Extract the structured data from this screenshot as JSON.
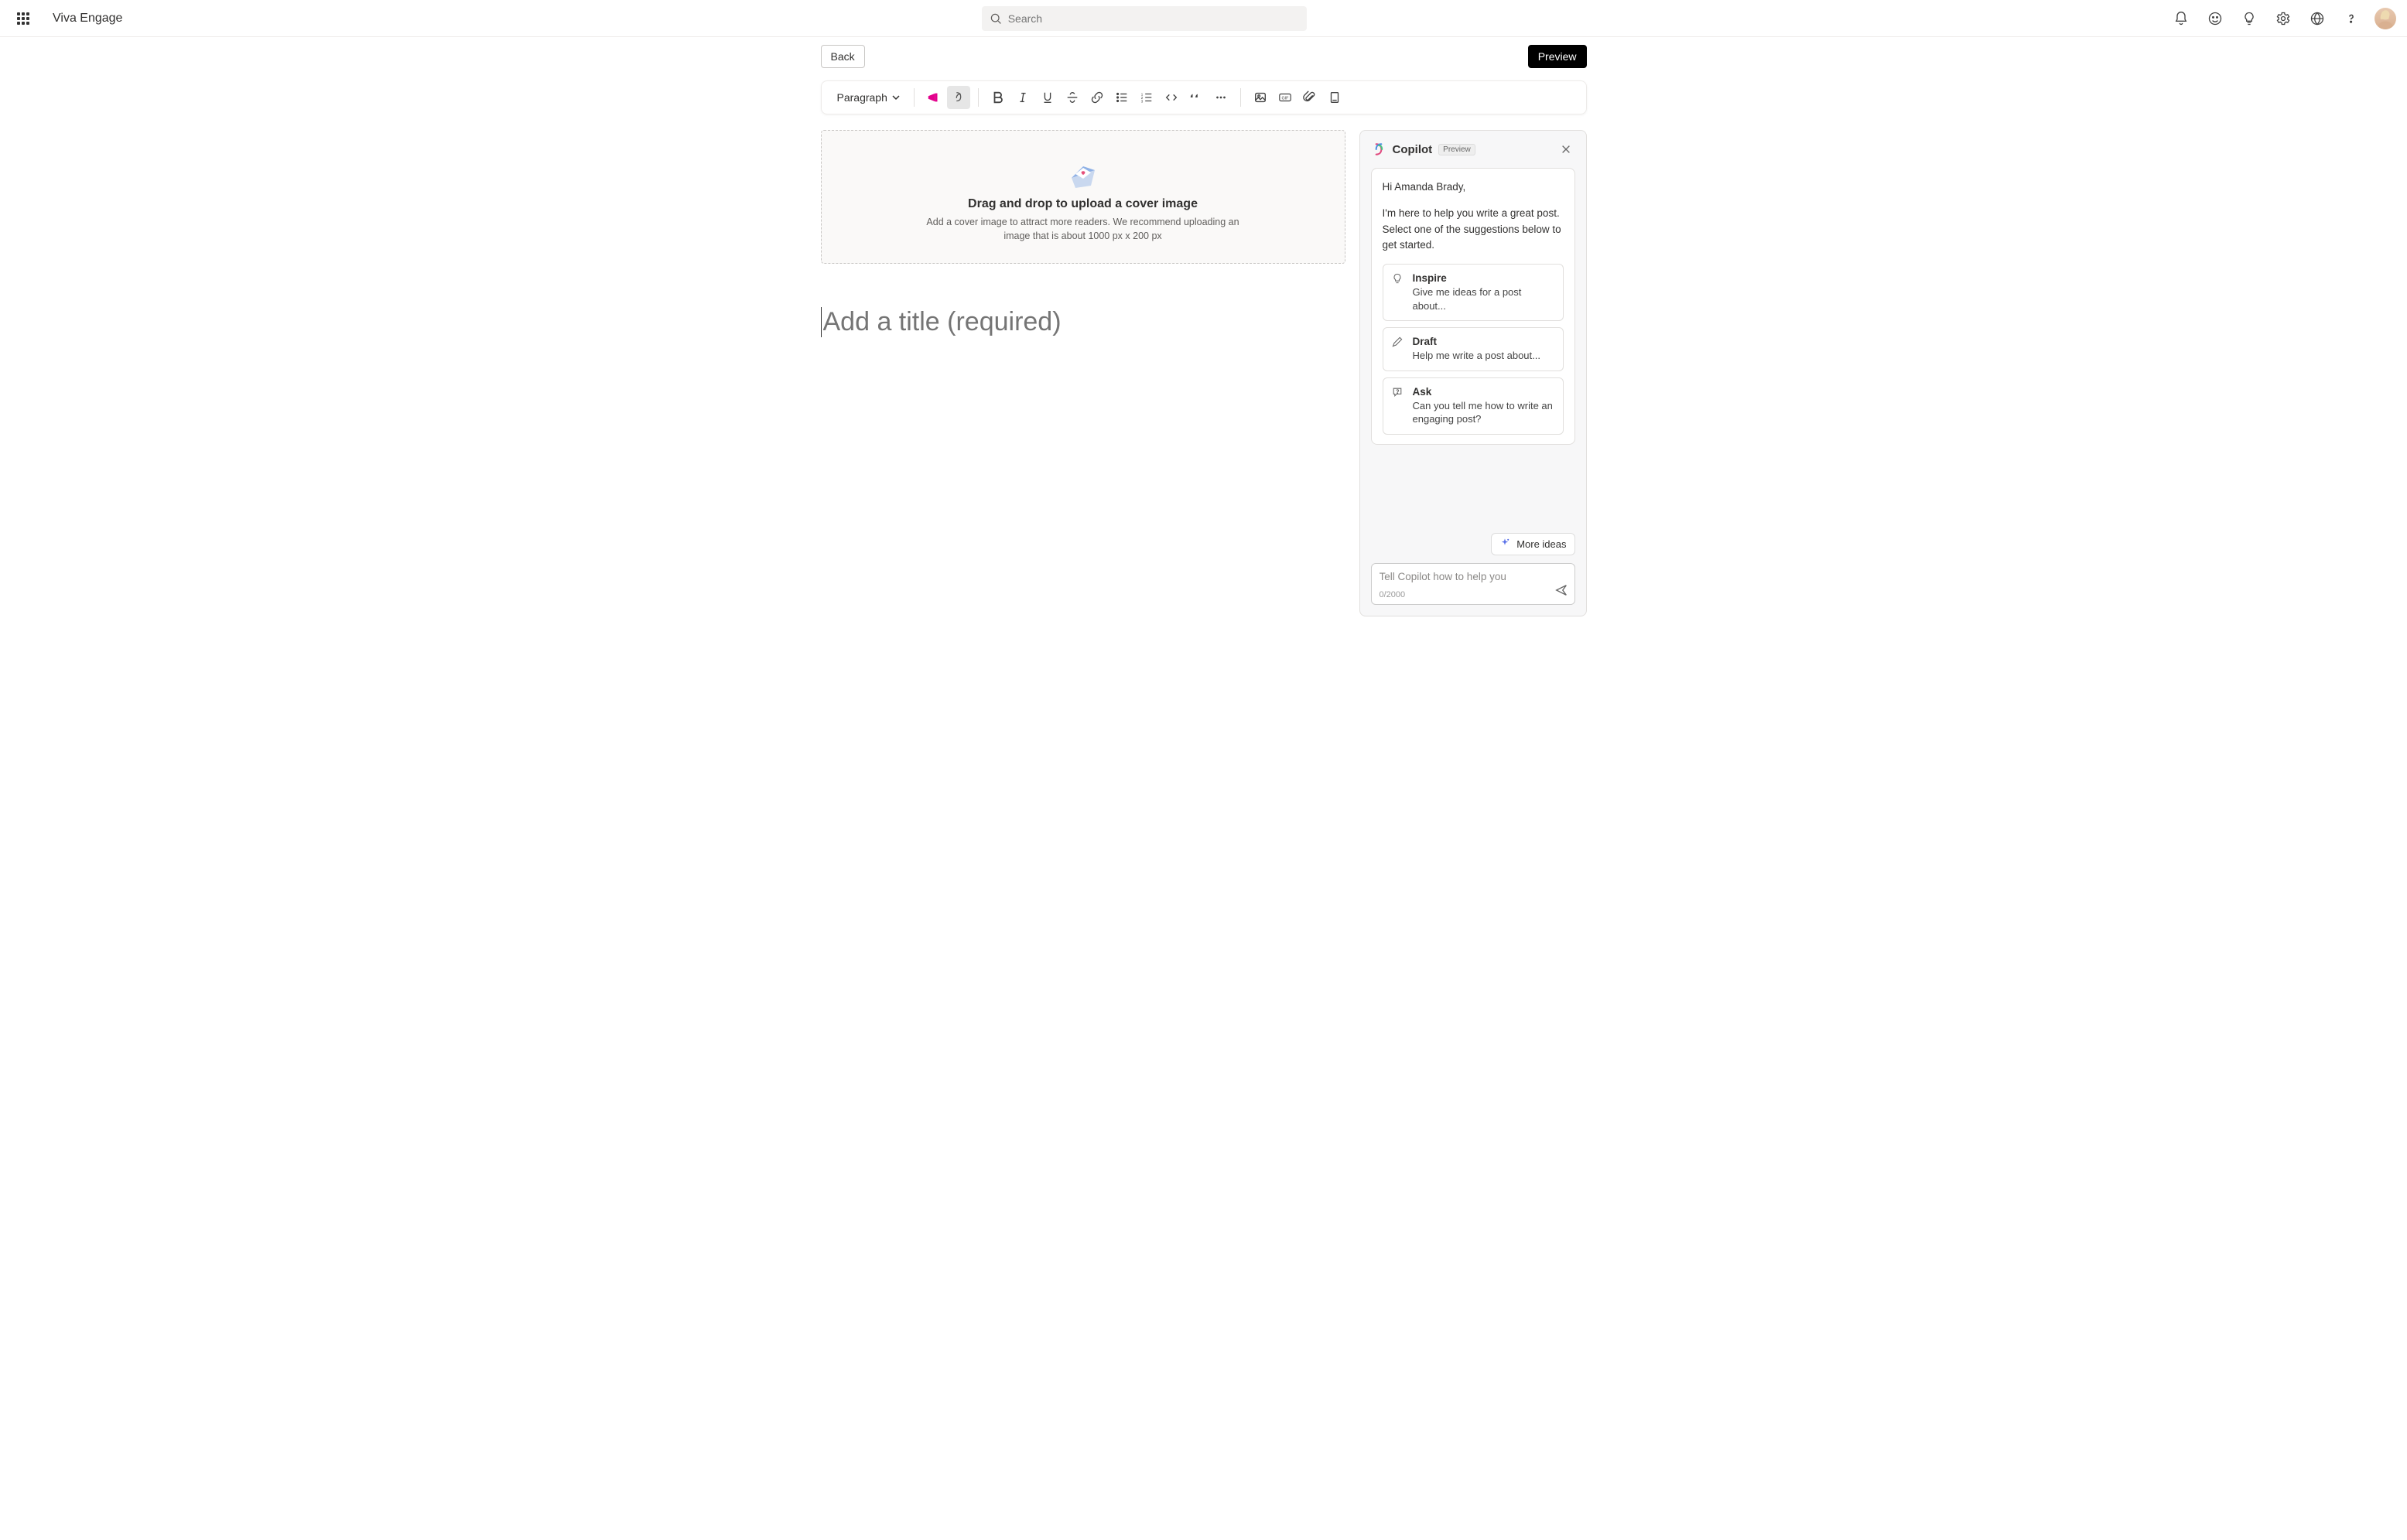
{
  "header": {
    "brand": "Viva Engage",
    "search_placeholder": "Search"
  },
  "actions": {
    "back": "Back",
    "preview": "Preview"
  },
  "toolbar": {
    "paragraph_label": "Paragraph"
  },
  "cover": {
    "heading": "Drag and drop to upload a cover image",
    "sub": "Add a cover image to attract more readers. We recommend uploading an image that is about 1000 px x 200 px"
  },
  "editor": {
    "title_placeholder": "Add a title (required)"
  },
  "copilot": {
    "title": "Copilot",
    "badge": "Preview",
    "greeting": "Hi Amanda Brady,",
    "intro": "I'm here to help you write a great post. Select one of the suggestions below to get started.",
    "suggestions": [
      {
        "title": "Inspire",
        "desc": "Give me ideas for a post about..."
      },
      {
        "title": "Draft",
        "desc": "Help me write a post about..."
      },
      {
        "title": "Ask",
        "desc": "Can you tell me how to write an engaging post?"
      }
    ],
    "more": "More ideas",
    "input_placeholder": "Tell Copilot how to help you",
    "counter": "0/2000"
  }
}
